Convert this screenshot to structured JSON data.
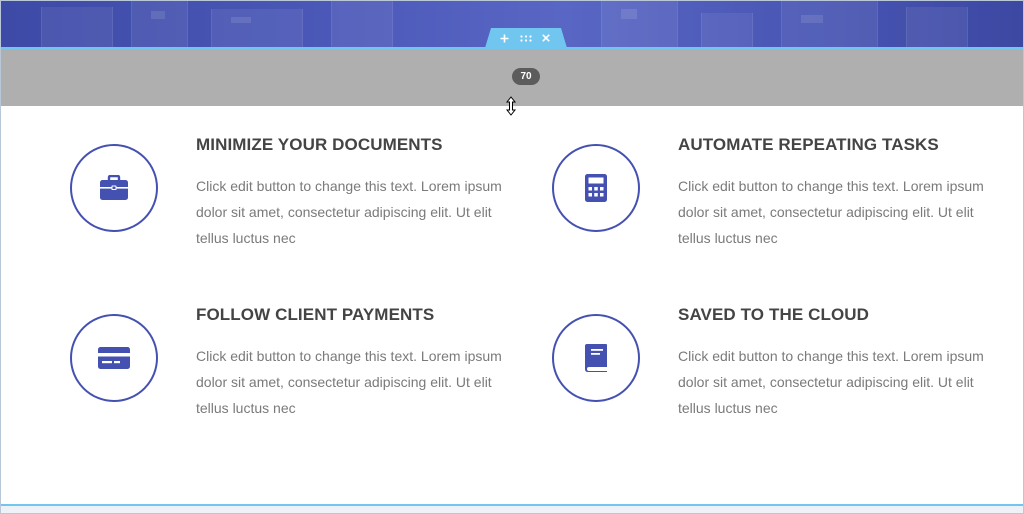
{
  "editor": {
    "padding_value": "70",
    "add_icon": "plus-icon",
    "drag_icon": "drag-handle-icon",
    "delete_icon": "close-icon",
    "accent_color": "#71c6f0",
    "padding_zone_color": "#afafaf"
  },
  "features": [
    {
      "title": "MINIMIZE YOUR DOCUMENTS",
      "description": "Click edit button to change this text. Lorem ipsum dolor sit amet, consectetur adipiscing elit. Ut elit tellus luctus nec",
      "icon": "briefcase-icon"
    },
    {
      "title": "AUTOMATE REPEATING TASKS",
      "description": "Click edit button to change this text. Lorem ipsum dolor sit amet, consectetur adipiscing elit. Ut elit tellus luctus nec",
      "icon": "calculator-icon"
    },
    {
      "title": "FOLLOW CLIENT PAYMENTS",
      "description": "Click edit button to change this text. Lorem ipsum dolor sit amet, consectetur adipiscing elit. Ut elit tellus luctus nec",
      "icon": "credit-card-icon"
    },
    {
      "title": "SAVED TO THE CLOUD",
      "description": "Click edit button to change this text. Lorem ipsum dolor sit amet, consectetur adipiscing elit. Ut elit tellus luctus nec",
      "icon": "book-icon"
    }
  ],
  "colors": {
    "icon_color": "#4451b0",
    "title_color": "#444444",
    "text_color": "#7a7a7a"
  }
}
